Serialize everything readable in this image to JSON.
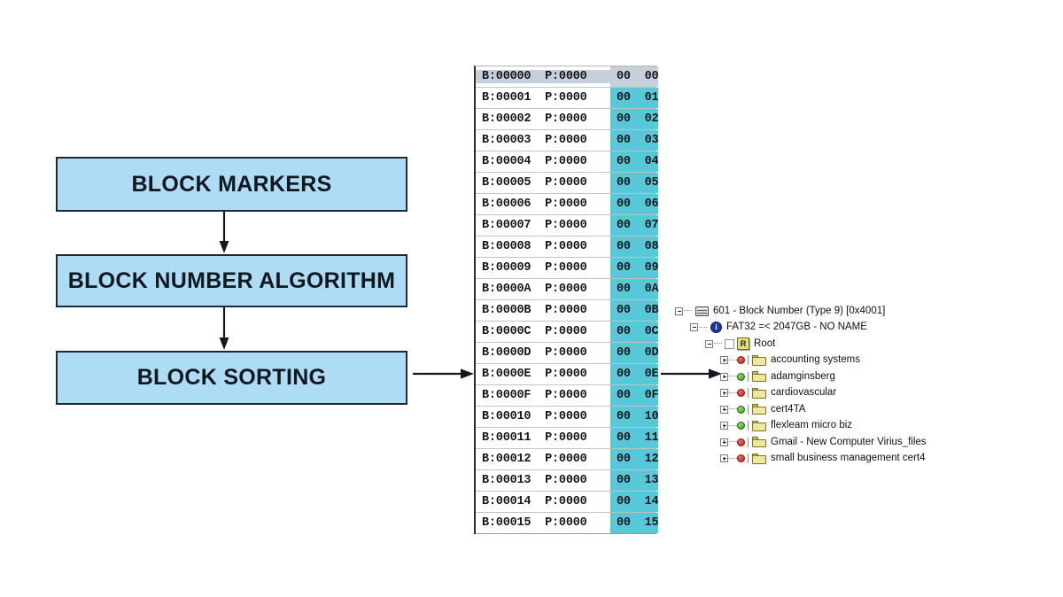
{
  "flowchart": {
    "boxes": [
      {
        "id": "block-markers",
        "label": "BLOCK MARKERS"
      },
      {
        "id": "block-number-algorithm",
        "label": "BLOCK NUMBER ALGORITHM"
      },
      {
        "id": "block-sorting",
        "label": "BLOCK SORTING"
      }
    ],
    "box_fill_color": "#AEDCF5",
    "box_border_color": "#1d2b36",
    "arrows": [
      {
        "id": "arrow-markers-to-algorithm",
        "direction": "down"
      },
      {
        "id": "arrow-algorithm-to-sorting",
        "direction": "down"
      },
      {
        "id": "arrow-sorting-to-hex-table",
        "direction": "right"
      },
      {
        "id": "arrow-hex-table-to-tree",
        "direction": "right"
      }
    ]
  },
  "hex_table": {
    "highlight_color": "#57C8D8",
    "selected_row_color": "#C7CEDC",
    "selected_index": 0,
    "rows": [
      {
        "address": "B:00000  P:0000",
        "value": "00  00"
      },
      {
        "address": "B:00001  P:0000",
        "value": "00  01"
      },
      {
        "address": "B:00002  P:0000",
        "value": "00  02"
      },
      {
        "address": "B:00003  P:0000",
        "value": "00  03"
      },
      {
        "address": "B:00004  P:0000",
        "value": "00  04"
      },
      {
        "address": "B:00005  P:0000",
        "value": "00  05"
      },
      {
        "address": "B:00006  P:0000",
        "value": "00  06"
      },
      {
        "address": "B:00007  P:0000",
        "value": "00  07"
      },
      {
        "address": "B:00008  P:0000",
        "value": "00  08"
      },
      {
        "address": "B:00009  P:0000",
        "value": "00  09"
      },
      {
        "address": "B:0000A  P:0000",
        "value": "00  0A"
      },
      {
        "address": "B:0000B  P:0000",
        "value": "00  0B"
      },
      {
        "address": "B:0000C  P:0000",
        "value": "00  0C"
      },
      {
        "address": "B:0000D  P:0000",
        "value": "00  0D"
      },
      {
        "address": "B:0000E  P:0000",
        "value": "00  0E"
      },
      {
        "address": "B:0000F  P:0000",
        "value": "00  0F"
      },
      {
        "address": "B:00010  P:0000",
        "value": "00  10"
      },
      {
        "address": "B:00011  P:0000",
        "value": "00  11"
      },
      {
        "address": "B:00012  P:0000",
        "value": "00  12"
      },
      {
        "address": "B:00013  P:0000",
        "value": "00  13"
      },
      {
        "address": "B:00014  P:0000",
        "value": "00  14"
      },
      {
        "address": "B:00015  P:0000",
        "value": "00  15"
      }
    ]
  },
  "tree": {
    "nodes": [
      {
        "id": "block-number-root",
        "label": "601 - Block Number (Type 9) [0x4001]",
        "icon": "drive-icon",
        "expander": "minus",
        "depth": 0
      },
      {
        "id": "fat32-volume",
        "label": "FAT32 =< 2047GB - NO NAME",
        "icon": "info-icon",
        "expander": "minus",
        "depth": 1
      },
      {
        "id": "root-folder",
        "label": "Root",
        "icon": "r-icon",
        "icon_text": "R",
        "expander": "minus",
        "checkbox": true,
        "depth": 2
      },
      {
        "id": "folder-accounting-systems",
        "label": "accounting systems",
        "icon": "folder-icon",
        "expander": "plus",
        "dot": "red",
        "depth": 3
      },
      {
        "id": "folder-adamginsberg",
        "label": "adamginsberg",
        "icon": "folder-icon",
        "expander": "plus",
        "dot": "green",
        "depth": 3
      },
      {
        "id": "folder-cardiovascular",
        "label": "cardiovascular",
        "icon": "folder-icon",
        "expander": "plus",
        "dot": "red",
        "depth": 3
      },
      {
        "id": "folder-cert4ta",
        "label": "cert4TA",
        "icon": "folder-icon",
        "expander": "plus",
        "dot": "green",
        "depth": 3
      },
      {
        "id": "folder-flexleam-micro-biz",
        "label": "flexleam micro biz",
        "icon": "folder-icon",
        "expander": "plus",
        "dot": "green",
        "depth": 3
      },
      {
        "id": "folder-gmail-virius-files",
        "label": "Gmail - New Computer Virius_files",
        "icon": "folder-icon",
        "expander": "plus",
        "dot": "red",
        "depth": 3
      },
      {
        "id": "folder-small-business-management-cert4",
        "label": "small business management cert4",
        "icon": "folder-icon",
        "expander": "plus",
        "dot": "red",
        "depth": 3
      }
    ],
    "info_icon_glyph": "i"
  }
}
